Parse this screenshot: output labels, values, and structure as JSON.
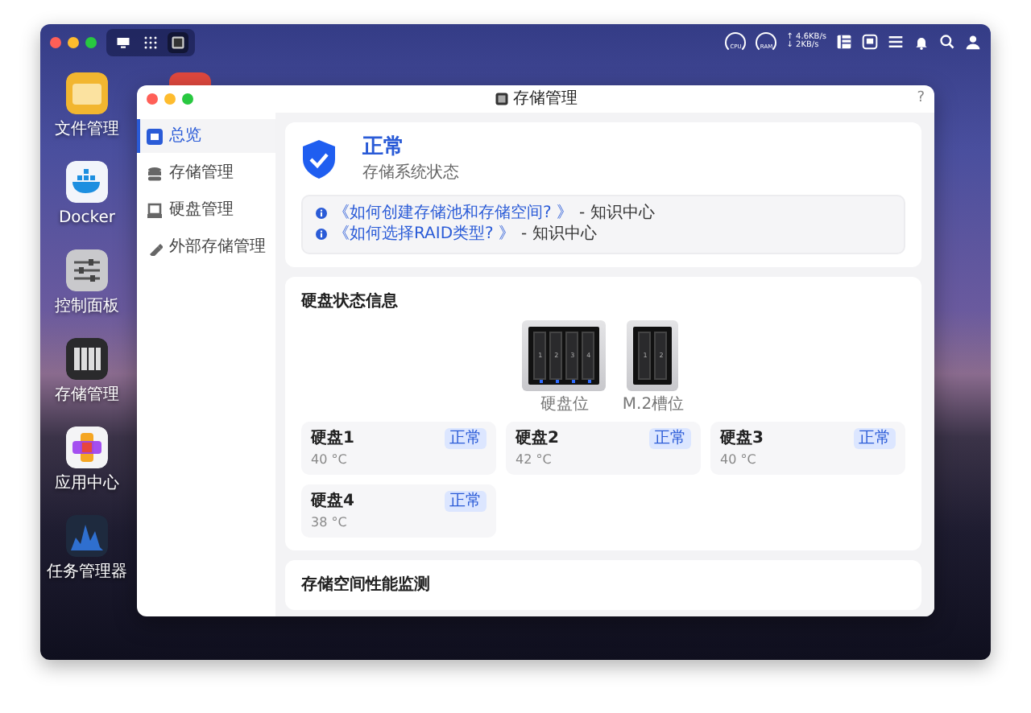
{
  "topbar": {
    "apps": [
      {
        "kind": "desktop",
        "selected": false
      },
      {
        "kind": "grid",
        "selected": false
      },
      {
        "kind": "storage",
        "selected": true
      }
    ],
    "gauges": [
      {
        "label": "CPU"
      },
      {
        "label": "RAM"
      }
    ],
    "network": {
      "upload": "↑ 4.6KB/s",
      "download": "↓ 2KB/s"
    },
    "tray": [
      {
        "kind": "list"
      },
      {
        "kind": "storage"
      },
      {
        "kind": "menu"
      },
      {
        "kind": "bell"
      },
      {
        "kind": "search"
      },
      {
        "kind": "user"
      }
    ]
  },
  "dock": [
    {
      "label": "文件管理",
      "kind": "files"
    },
    {
      "label": "Docker",
      "kind": "docker"
    },
    {
      "label": "控制面板",
      "kind": "control"
    },
    {
      "label": "存储管理",
      "kind": "storage"
    },
    {
      "label": "应用中心",
      "kind": "apps"
    },
    {
      "label": "任务管理器",
      "kind": "tasks"
    }
  ],
  "window": {
    "title": "存储管理",
    "help": "?",
    "sidebar": [
      {
        "label": "总览",
        "kind": "overview",
        "selected": true
      },
      {
        "label": "存储管理",
        "kind": "storage",
        "selected": false
      },
      {
        "label": "硬盘管理",
        "kind": "disk",
        "selected": false
      },
      {
        "label": "外部存储管理",
        "kind": "external",
        "selected": false
      }
    ],
    "status": {
      "title": "正常",
      "subtitle": "存储系统状态"
    },
    "links": [
      {
        "link": "《如何创建存储池和存储空间? 》",
        "suffix": "- 知识中心"
      },
      {
        "link": "《如何选择RAID类型? 》",
        "suffix": "- 知识中心"
      }
    ],
    "disk_section": {
      "title": "硬盘状态信息",
      "bays": [
        {
          "label": "硬盘位",
          "kind": "hdd",
          "slots": [
            "1",
            "2",
            "3",
            "4"
          ]
        },
        {
          "label": "M.2槽位",
          "kind": "m2",
          "slots": [
            "1",
            "2"
          ]
        }
      ],
      "disks": [
        {
          "name": "硬盘1",
          "status": "正常",
          "temp": "40 °C"
        },
        {
          "name": "硬盘2",
          "status": "正常",
          "temp": "42 °C"
        },
        {
          "name": "硬盘3",
          "status": "正常",
          "temp": "40 °C"
        },
        {
          "name": "硬盘4",
          "status": "正常",
          "temp": "38 °C"
        }
      ]
    },
    "next_section": {
      "title": "存储空间性能监测"
    }
  }
}
